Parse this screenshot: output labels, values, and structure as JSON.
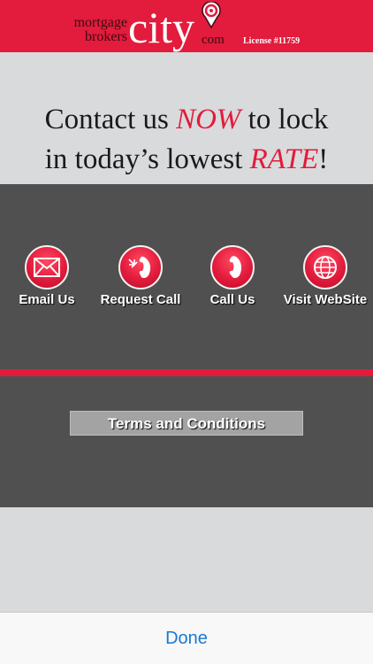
{
  "header": {
    "logo_mortgage": "mortgage",
    "logo_brokers": "brokers",
    "logo_city": "city",
    "logo_com": "com",
    "license": "License #11759"
  },
  "headline": {
    "line1_a": "Contact us ",
    "line1_em": "NOW",
    "line1_b": " to lock",
    "line2_a": "in today’s lowest ",
    "line2_em": "RATE",
    "line2_b": "!"
  },
  "actions": [
    {
      "label": "Email Us",
      "icon": "envelope-icon"
    },
    {
      "label": "Request Call",
      "icon": "phone-callback-icon"
    },
    {
      "label": "Call Us",
      "icon": "phone-icon"
    },
    {
      "label": "Visit WebSite",
      "icon": "globe-icon"
    }
  ],
  "terms_label": "Terms and Conditions",
  "toolbar": {
    "done_label": "Done"
  },
  "colors": {
    "brand_red": "#e31b3c",
    "panel_gray": "#505050",
    "link_blue": "#1a78d2"
  }
}
